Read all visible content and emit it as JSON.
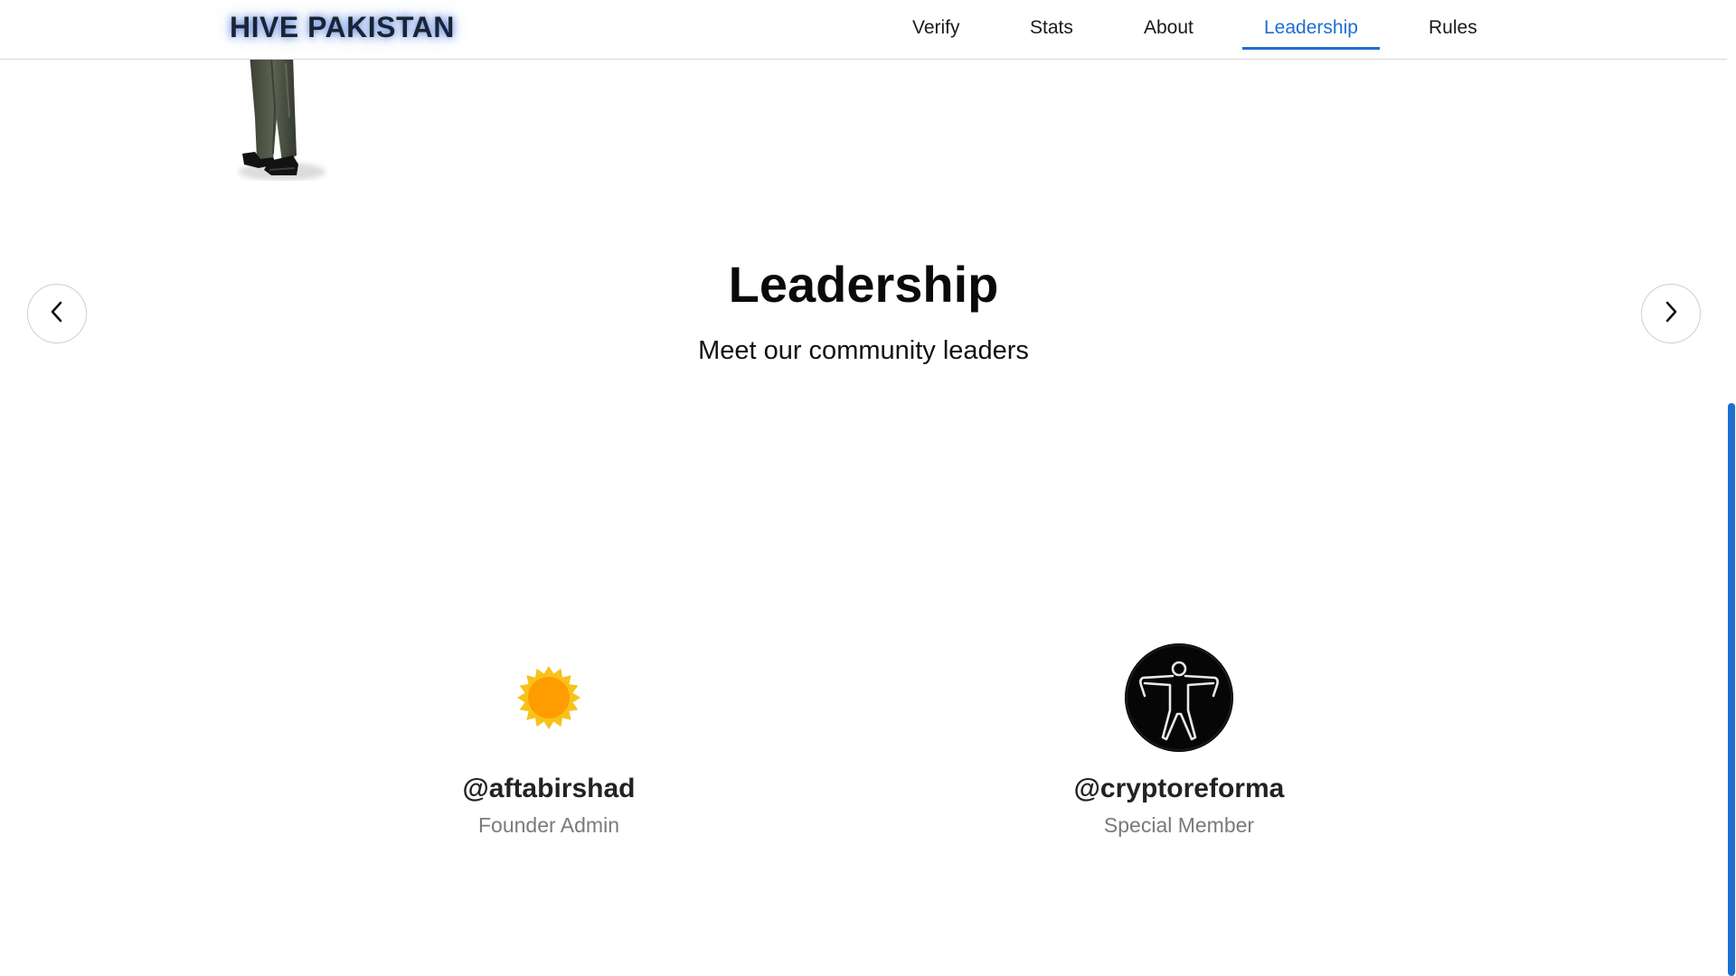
{
  "header": {
    "brand": "HIVE PAKISTAN",
    "nav": [
      {
        "label": "Verify",
        "active": false
      },
      {
        "label": "Stats",
        "active": false
      },
      {
        "label": "About",
        "active": false
      },
      {
        "label": "Leadership",
        "active": true
      },
      {
        "label": "Rules",
        "active": false
      }
    ]
  },
  "hero": {
    "title": "Leadership",
    "subtitle": "Meet our community leaders"
  },
  "carousel": {
    "prev_icon": "chevron-left-icon",
    "next_icon": "chevron-right-icon"
  },
  "leaders": [
    {
      "handle": "@aftabirshad",
      "role": "Founder Admin",
      "avatar": "sun-icon"
    },
    {
      "handle": "@cryptoreforma",
      "role": "Special Member",
      "avatar": "human-figure-avatar"
    }
  ],
  "colors": {
    "accent": "#1e6fd0",
    "brand_glow": "#4678dc",
    "role_text": "#7a7a7a",
    "sun_outer": "#f7c21a",
    "sun_inner": "#ff9c00"
  }
}
